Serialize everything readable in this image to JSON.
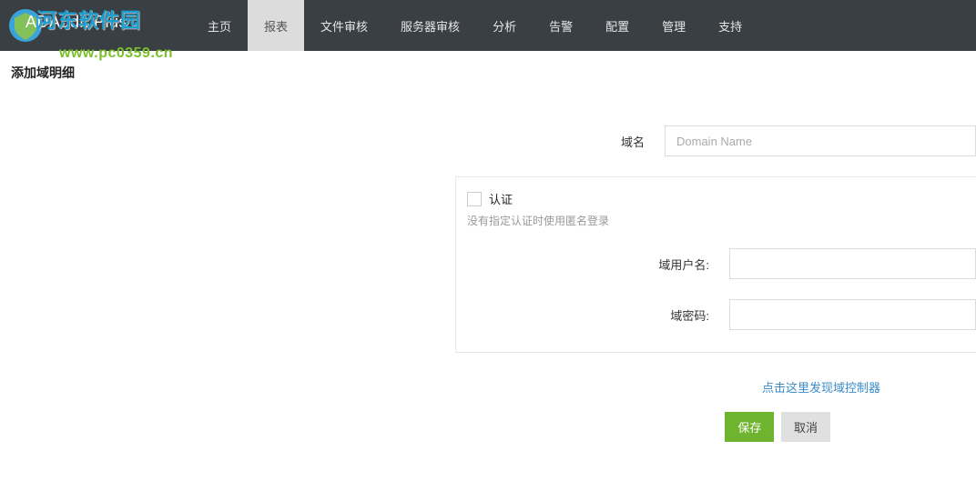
{
  "watermark": {
    "line1": "河东软件园",
    "line2": "www.pc0359.cn"
  },
  "header": {
    "brand": "ADAudit Plus"
  },
  "nav": {
    "items": [
      {
        "label": "主页"
      },
      {
        "label": "报表"
      },
      {
        "label": "文件审核"
      },
      {
        "label": "服务器审核"
      },
      {
        "label": "分析"
      },
      {
        "label": "告警"
      },
      {
        "label": "配置"
      },
      {
        "label": "管理"
      },
      {
        "label": "支持"
      }
    ],
    "active_index": 1
  },
  "page": {
    "title": "添加域明细"
  },
  "form": {
    "domain_label": "域名",
    "domain_placeholder": "Domain Name",
    "auth": {
      "checkbox_label": "认证",
      "note": "没有指定认证时使用匿名登录",
      "user_label": "域用户名:",
      "pass_label": "域密码:"
    },
    "discover_link": "点击这里发现域控制器",
    "save_label": "保存",
    "cancel_label": "取消"
  }
}
